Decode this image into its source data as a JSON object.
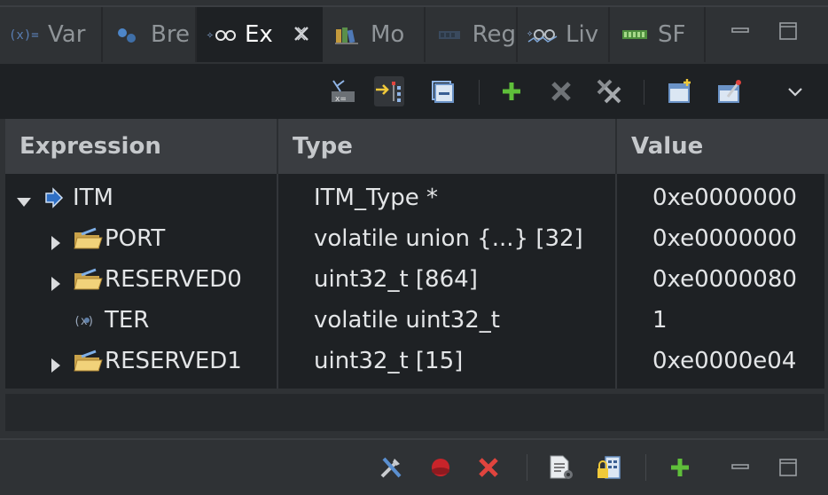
{
  "tabs": [
    {
      "label": "Var",
      "icon": "variables-icon"
    },
    {
      "label": "Bre",
      "icon": "breakpoints-icon"
    },
    {
      "label": "Ex",
      "icon": "expressions-icon",
      "active": true
    },
    {
      "label": "Mo",
      "icon": "modules-icon"
    },
    {
      "label": "Reg",
      "icon": "registers-icon"
    },
    {
      "label": "Liv",
      "icon": "live-expressions-icon"
    },
    {
      "label": "SF",
      "icon": "sfr-icon"
    }
  ],
  "columns": {
    "expression": "Expression",
    "type": "Type",
    "value": "Value"
  },
  "rows": [
    {
      "expression": "ITM",
      "type": "ITM_Type *",
      "value": "0xe0000000",
      "expanded": true,
      "icon": "pointer-icon"
    },
    {
      "expression": "PORT",
      "type": "volatile union {...} [32]",
      "value": "0xe0000000",
      "expanded": false,
      "icon": "folder-icon"
    },
    {
      "expression": "RESERVED0",
      "type": "uint32_t [864]",
      "value": "0xe0000080",
      "expanded": false,
      "icon": "folder-icon"
    },
    {
      "expression": "TER",
      "type": "volatile uint32_t",
      "value": "1",
      "icon": "field-icon"
    },
    {
      "expression": "RESERVED1",
      "type": "uint32_t [15]",
      "value": "0xe0000e04",
      "expanded": false,
      "icon": "folder-icon"
    }
  ],
  "colors": {
    "panel_bg": "#1e2124",
    "chrome_bg": "#2f3235",
    "header_bg": "#3a3d41",
    "add_green": "#5fbf3a",
    "remove_red": "#e0443e"
  }
}
